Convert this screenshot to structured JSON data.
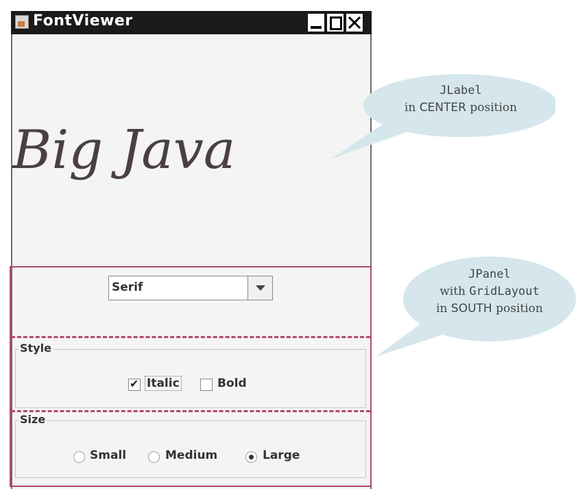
{
  "window": {
    "title": "FontViewer"
  },
  "label": {
    "text": "Big Java"
  },
  "font_combo": {
    "selected": "Serif"
  },
  "style_group": {
    "title": "Style",
    "italic": {
      "label": "Italic",
      "checked": true
    },
    "bold": {
      "label": "Bold",
      "checked": false
    }
  },
  "size_group": {
    "title": "Size",
    "options": [
      {
        "label": "Small",
        "selected": false
      },
      {
        "label": "Medium",
        "selected": false
      },
      {
        "label": "Large",
        "selected": true
      }
    ]
  },
  "callouts": {
    "label_callout": {
      "line1": "JLabel",
      "line2_word": "CENTER",
      "line2_prefix": "in ",
      "line2_suffix": " position"
    },
    "panel_callout": {
      "line1": "JPanel",
      "line2_prefix": "with ",
      "line2_word": "GridLayout",
      "line3_prefix": "in ",
      "line3_word": "SOUTH",
      "line3_suffix": " position"
    }
  },
  "colors": {
    "panel_border": "#b04a6a",
    "callout_fill": "#d5e7ec"
  }
}
